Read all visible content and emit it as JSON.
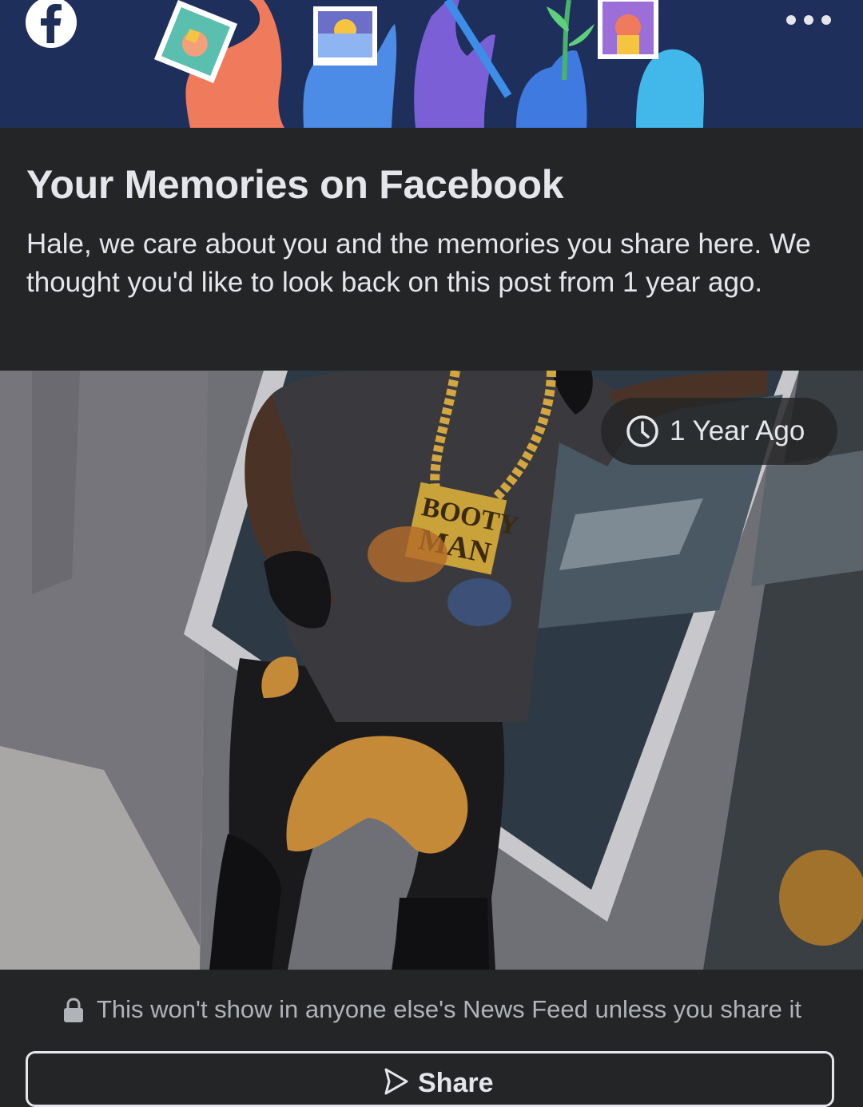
{
  "banner": {
    "logo_icon": "facebook-logo-icon",
    "more_icon": "more-dots-icon"
  },
  "header": {
    "title": "Your Memories on Facebook",
    "description": "Hale, we care about you and the memories you share here. We thought you'd like to look back on this post from 1 year ago."
  },
  "photo": {
    "time_badge": "1 Year Ago",
    "time_icon": "clock-icon"
  },
  "footer": {
    "privacy_text": "This won't show in anyone else's News Feed unless you share it",
    "lock_icon": "lock-icon",
    "share_label": "Share",
    "share_icon": "share-arrow-icon"
  },
  "colors": {
    "banner_bg": "#1e2f5c",
    "card_bg": "#242526",
    "text_primary": "#e4e6eb",
    "text_secondary": "#b0b3b8"
  }
}
